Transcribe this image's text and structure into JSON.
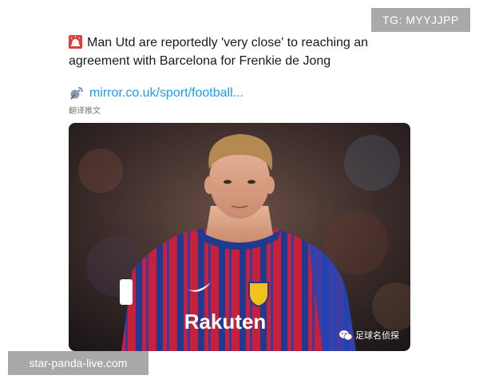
{
  "watermarks": {
    "telegram": "TG: MYYJJPP",
    "site": "star-panda-live.com",
    "brand": "足球名侦探"
  },
  "tweet": {
    "headline": "Man Utd are reportedly 'very close' to reaching an agreement with Barcelona for Frenkie de Jong",
    "link": "mirror.co.uk/sport/football...",
    "translate_label": "翻译推文",
    "icons": [
      "police-siren-icon",
      "satellite-antenna-icon"
    ]
  },
  "photo": {
    "kit_sponsor": "Rakuten",
    "colors": {
      "shirt_red": "#c8203a",
      "shirt_blue": "#1f3a8f",
      "background": "#3a2a28"
    }
  }
}
